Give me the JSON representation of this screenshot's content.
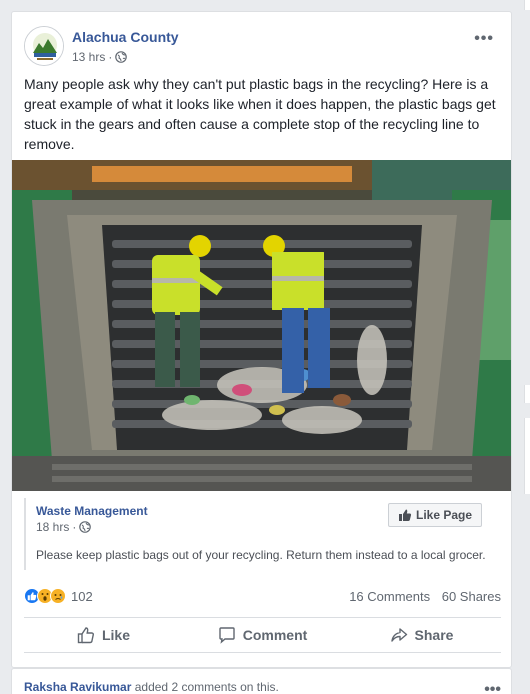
{
  "post": {
    "page_name": "Alachua County",
    "time": "13 hrs",
    "dot": "·",
    "more": "•••",
    "text": "Many people ask why they can't put plastic bags in the recycling? Here is a great example of what it looks like when it does happen, the plastic bags get stuck in the gears and often cause a complete stop of the recycling line to remove.",
    "photo_icon": "recycling-sorting-line-photo"
  },
  "shared": {
    "page_name": "Waste Management",
    "time": "18 hrs",
    "dot": "·",
    "like_page_label": "Like Page",
    "note": "Please keep plastic bags out of your recycling. Return them instead to a local grocer."
  },
  "stats": {
    "reaction_icons": [
      "like-icon",
      "wow-icon",
      "sad-icon"
    ],
    "reaction_count": "102",
    "comments": "16 Comments",
    "shares": "60 Shares"
  },
  "actions": {
    "like": "Like",
    "comment": "Comment",
    "share": "Share"
  },
  "next": {
    "user": "Raksha Ravikumar",
    "activity": "added 2 comments on this.",
    "more": "•••"
  },
  "colors": {
    "link": "#385898",
    "like_blue": "#1877f2",
    "wow_yellow": "#f7b125"
  }
}
